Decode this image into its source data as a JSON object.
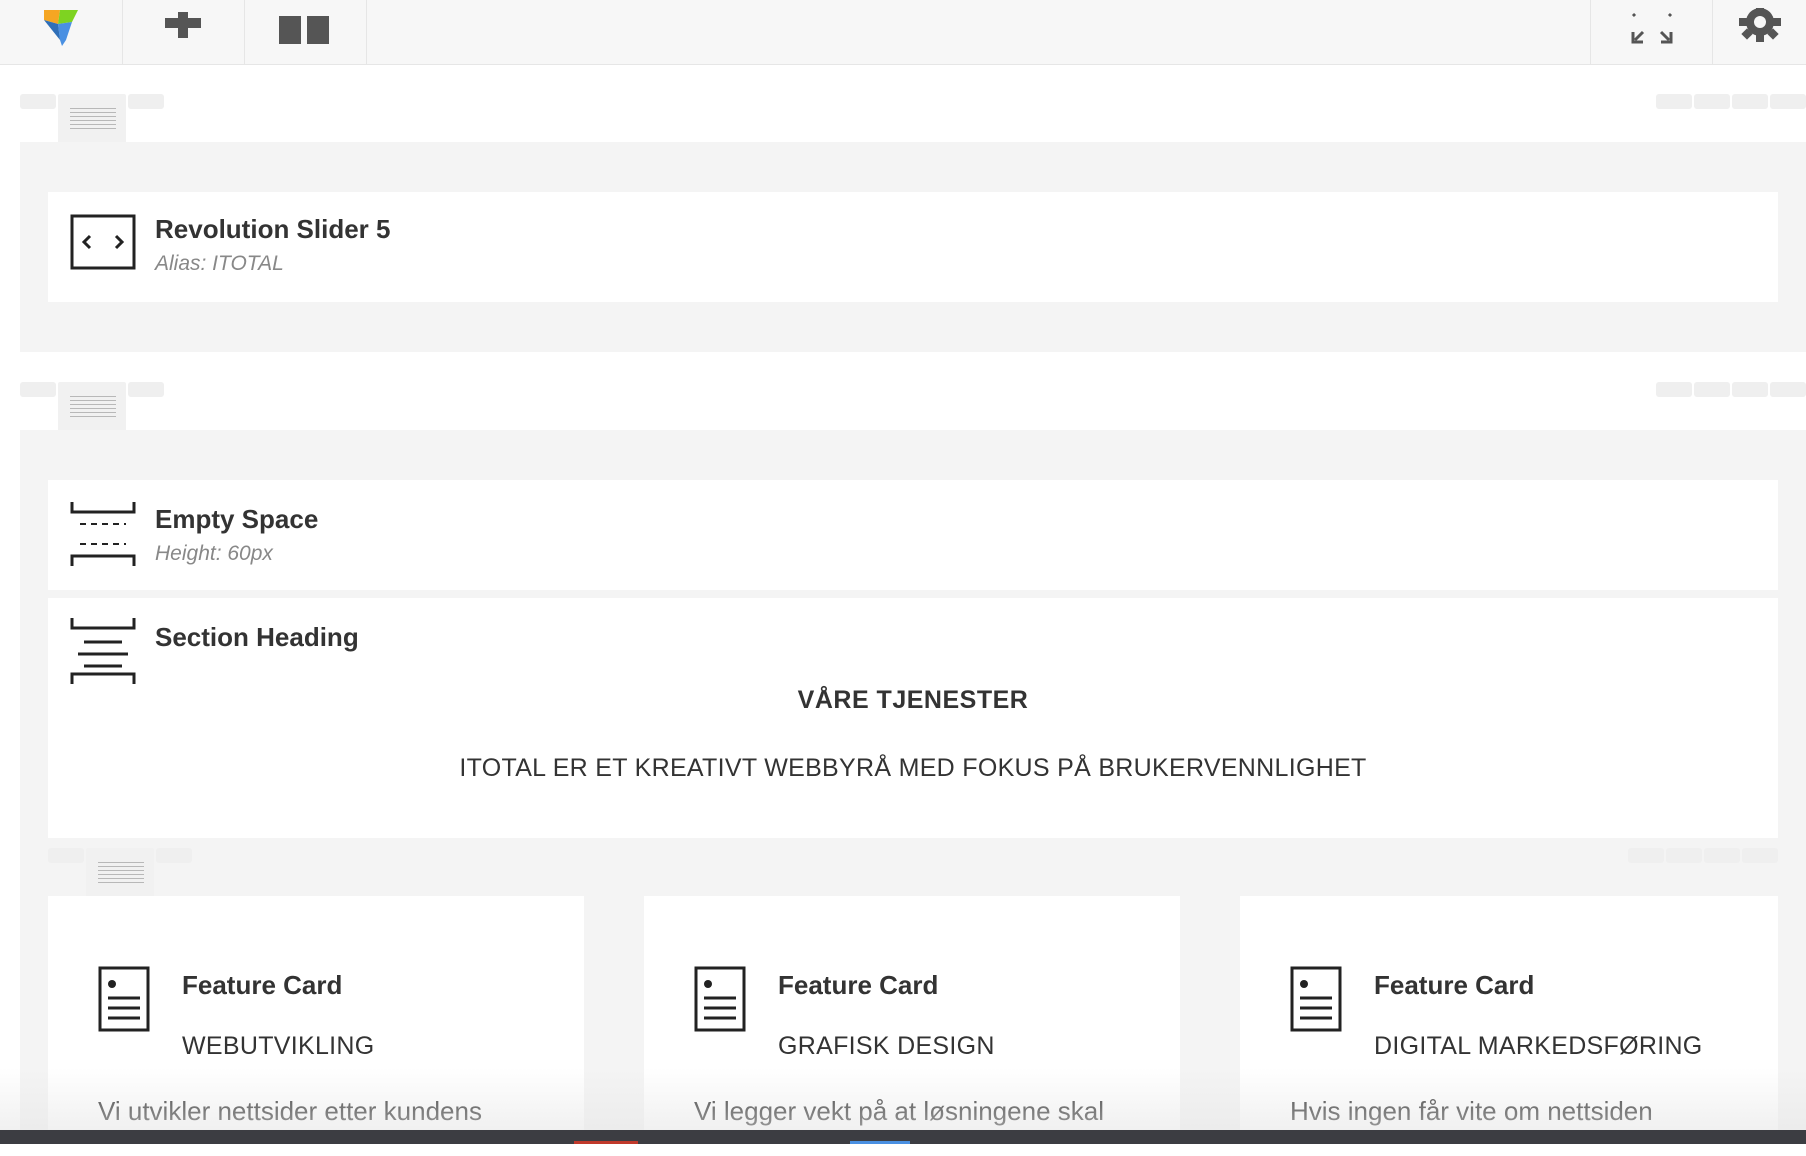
{
  "toolbar": {
    "left_buttons": [
      "logo-icon",
      "plus-icon",
      "layout-icon"
    ],
    "right_buttons": [
      "fullscreen-icon",
      "gear-icon"
    ],
    "accent_colors": [
      "#f5a623",
      "#4a90e2",
      "#7ed321"
    ]
  },
  "rows": [
    {
      "elements": [
        {
          "icon": "code-brackets-icon",
          "title": "Revolution Slider 5",
          "subtitle": "Alias: ITOTAL"
        }
      ]
    },
    {
      "elements": [
        {
          "icon": "empty-space-icon",
          "title": "Empty Space",
          "subtitle": "Height: 60px"
        },
        {
          "icon": "section-heading-icon",
          "title": "Section Heading",
          "heading": "VÅRE TJENESTER",
          "tagline": "ITOTAL ER ET KREATIVT WEBBYRÅ MED FOKUS PÅ BRUKERVENNLIGHET"
        }
      ],
      "inner_row": {
        "cards": [
          {
            "icon": "document-icon",
            "title": "Feature Card",
            "subtitle": "WEBUTVIKLING",
            "text": "Vi utvikler nettsider etter kundens"
          },
          {
            "icon": "document-icon",
            "title": "Feature Card",
            "subtitle": "GRAFISK DESIGN",
            "text": "Vi legger vekt på at løsningene skal"
          },
          {
            "icon": "document-icon",
            "title": "Feature Card",
            "subtitle": "DIGITAL MARKEDSFØRING",
            "text": "Hvis ingen får vite om nettsiden"
          }
        ]
      }
    }
  ]
}
